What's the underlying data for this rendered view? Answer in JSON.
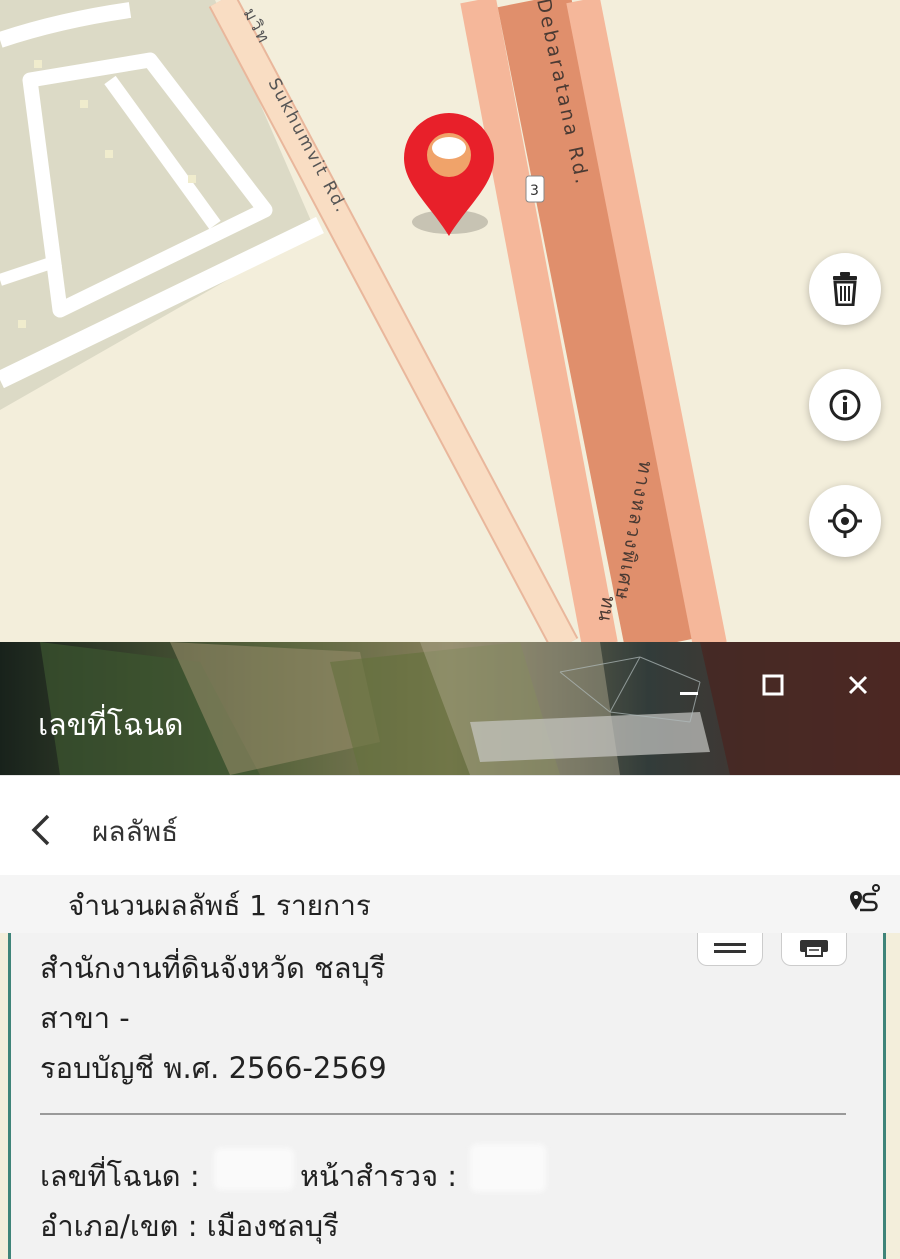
{
  "map": {
    "road_labels": {
      "sukhumvit": "Sukhumvit Rd.",
      "sukhumvit_thai_fragment": "มวิท",
      "debaratana": "Debaratana Rd.",
      "route_number": "3",
      "thai_highway": "ทางหลวงพิเศษ",
      "thai_fragment": "ทน"
    },
    "buttons": {
      "delete_icon": "trash-icon",
      "info_icon": "info-icon",
      "locate_icon": "crosshair-icon"
    },
    "colors": {
      "map_background": "#f3eedb",
      "block_fill": "#dcdac6",
      "major_road": "#e08f6c",
      "road_border": "#f5b79a",
      "minor_road": "#f9ddc3",
      "pin": "#e8202a"
    }
  },
  "panel": {
    "title": "เลขที่โฉนด",
    "minimize_icon": "minimize-icon",
    "maximize_icon": "maximize-icon",
    "close_icon": "close-icon"
  },
  "results": {
    "back_icon": "chevron-left-icon",
    "title": "ผลลัพธ์",
    "count_text": "จำนวนผลลัพธ์ 1 รายการ",
    "route_icon": "route-pin-icon"
  },
  "card": {
    "office": "สำนักงานที่ดินจังหวัด ชลบุรี",
    "branch": "สาขา -",
    "fiscal": "รอบบัญชี พ.ศ. 2566-2569",
    "deed_label": "เลขที่โฉนด :",
    "survey_label": "หน้าสำรวจ :",
    "district": "อำเภอ/เขต : เมืองชลบุรี",
    "menu_icon": "menu-icon",
    "print_icon": "print-icon",
    "accent_color": "#3f8479"
  }
}
